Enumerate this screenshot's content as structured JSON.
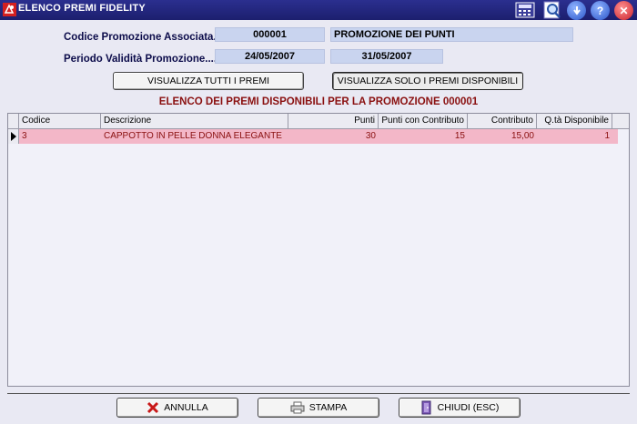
{
  "window": {
    "title": "ELENCO PREMI FIDELITY"
  },
  "form": {
    "codice_label": "Codice Promozione Associata....",
    "codice_value": "000001",
    "descrizione_value": "PROMOZIONE DEI PUNTI",
    "periodo_label": "Periodo Validità Promozione.......",
    "data_inizio": "24/05/2007",
    "data_fine": "31/05/2007"
  },
  "filters": {
    "tutti_label": "VISUALIZZA TUTTI I PREMI",
    "disponibili_label": "VISUALIZZA SOLO I PREMI DISPONIBILI"
  },
  "heading": "ELENCO DEI PREMI DISPONIBILI PER LA PROMOZIONE 000001",
  "table": {
    "columns": [
      "Codice",
      "Descrizione",
      "Punti",
      "Punti con Contributo",
      "Contributo",
      "Q.tà Disponibile"
    ],
    "rows": [
      {
        "codice": "3",
        "descrizione": "CAPPOTTO IN PELLE DONNA ELEGANTE",
        "punti": "30",
        "punti_contributo": "15",
        "contributo": "15,00",
        "qta": "1"
      }
    ]
  },
  "actions": {
    "annulla": "ANNULLA",
    "stampa": "STAMPA",
    "chiudi": "CHIUDI (ESC)"
  },
  "colors": {
    "titlebar": "#1c1f6e",
    "selected_row": "#f3b7c8",
    "heading": "#8a1010",
    "field_bg": "#c9d4ef"
  },
  "icons": [
    "app-logo-icon",
    "calculator-icon",
    "search-icon",
    "download-icon",
    "help-icon",
    "close-icon",
    "cancel-x-icon",
    "printer-icon",
    "exit-door-icon"
  ]
}
